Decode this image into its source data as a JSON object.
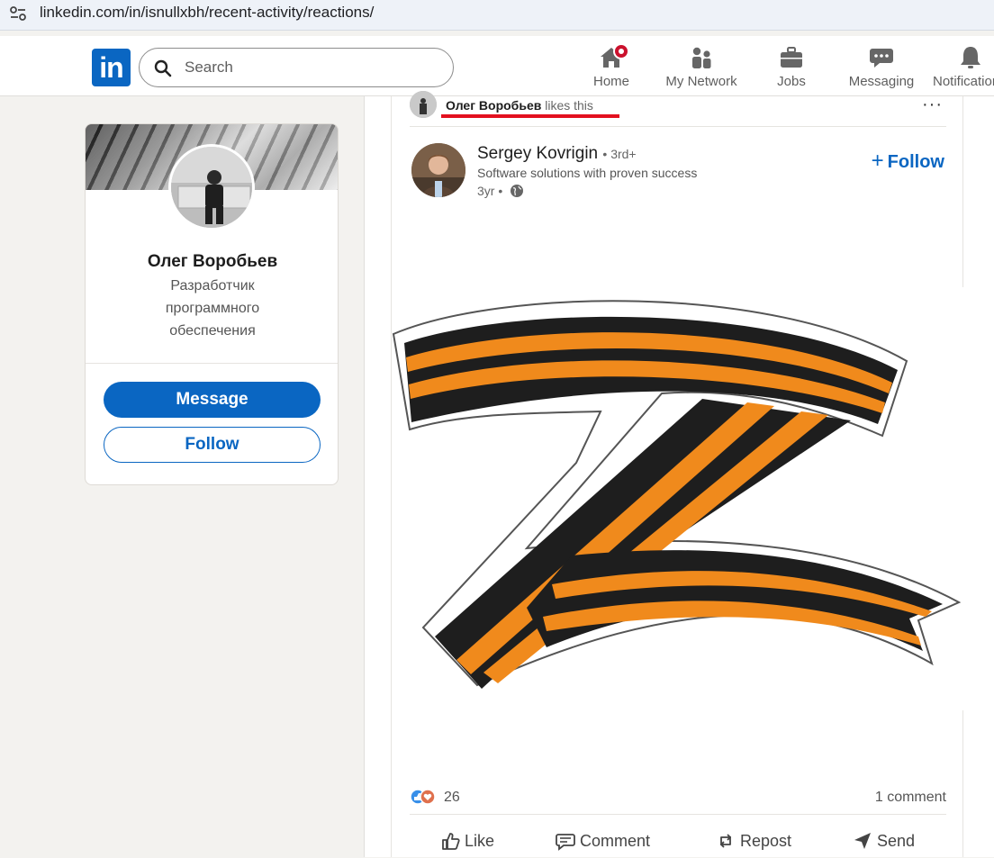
{
  "browser": {
    "url": "linkedin.com/in/isnullxbh/recent-activity/reactions/"
  },
  "header": {
    "logo": "in",
    "search": {
      "placeholder": "Search"
    },
    "nav": [
      {
        "label": "Home",
        "icon": "home-icon",
        "notification": true
      },
      {
        "label": "My Network",
        "icon": "people-icon"
      },
      {
        "label": "Jobs",
        "icon": "briefcase-icon"
      },
      {
        "label": "Messaging",
        "icon": "chat-icon"
      },
      {
        "label": "Notifications",
        "icon": "bell-icon"
      }
    ]
  },
  "profile": {
    "name": "Олег Воробьев",
    "headline": "Разработчик программного обеспечения",
    "message_label": "Message",
    "follow_label": "Follow"
  },
  "post": {
    "context": {
      "name": "Олег Воробьев",
      "suffix": " likes this",
      "more_label": "···"
    },
    "author": {
      "name": "Sergey Kovrigin",
      "degree": "• 3rd+",
      "subtitle": "Software solutions with proven success",
      "time": "3yr •"
    },
    "follow_label": "Follow",
    "image_description_icon": "z-letter-ribbon-image",
    "reaction_count": "26",
    "comment_count": "1 comment",
    "actions": [
      "Like",
      "Comment",
      "Repost",
      "Send"
    ]
  },
  "colors": {
    "linkedin_blue": "#0a66c2",
    "badge_red": "#cb112d",
    "underline_red": "#e3101f",
    "ribbon_orange": "#f08a1c",
    "ribbon_black": "#1e1e1e"
  }
}
